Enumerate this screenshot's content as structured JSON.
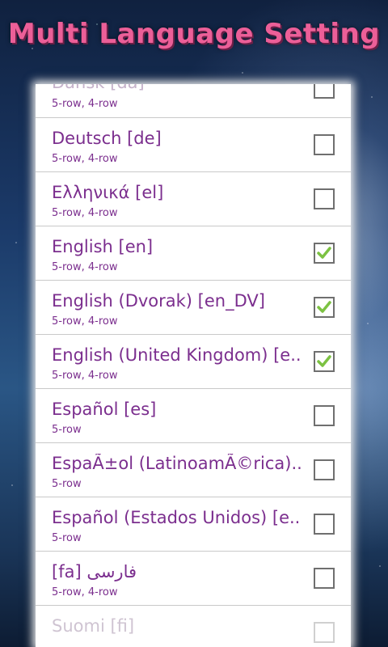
{
  "header": {
    "title": "Multi Language Setting"
  },
  "languages": [
    {
      "name": "Dansk [da]",
      "layouts": "5-row, 4-row",
      "checked": false
    },
    {
      "name": "Deutsch [de]",
      "layouts": "5-row, 4-row",
      "checked": false
    },
    {
      "name": "Ελληνικά [el]",
      "layouts": "5-row, 4-row",
      "checked": false
    },
    {
      "name": "English [en]",
      "layouts": "5-row, 4-row",
      "checked": true
    },
    {
      "name": "English (Dvorak) [en_DV]",
      "layouts": "5-row, 4-row",
      "checked": true
    },
    {
      "name": "English (United Kingdom) [e..",
      "layouts": "5-row, 4-row",
      "checked": true
    },
    {
      "name": "Español [es]",
      "layouts": "5-row",
      "checked": false
    },
    {
      "name": "EspaÃ±ol (LatinoamÃ©rica)..",
      "layouts": "5-row",
      "checked": false
    },
    {
      "name": "Español (Estados Unidos) [e..",
      "layouts": "5-row",
      "checked": false
    },
    {
      "name": "[fa] فارسی",
      "layouts": "5-row, 4-row",
      "checked": false
    },
    {
      "name": "Suomi [fi]",
      "layouts": "",
      "checked": false
    }
  ],
  "colors": {
    "title": "#ec5f98",
    "text": "#7b2e8e",
    "check": "#7cc242"
  }
}
